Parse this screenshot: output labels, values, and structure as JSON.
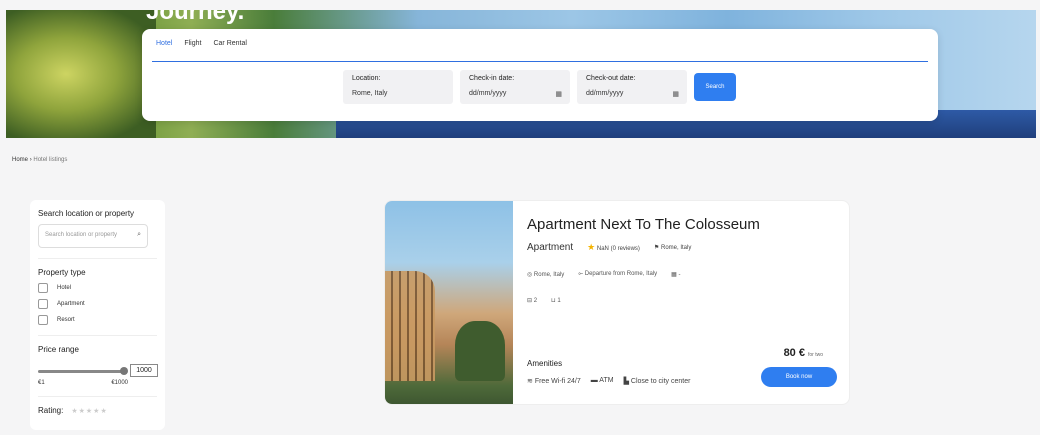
{
  "hero": {
    "title": "Journey."
  },
  "search": {
    "tabs": [
      "Hotel",
      "Flight",
      "Car Rental"
    ],
    "location_label": "Location:",
    "location_value": "Rome, Italy",
    "checkin_label": "Check-in date:",
    "checkin_value": "dd/mm/yyyy",
    "checkout_label": "Check-out date:",
    "checkout_value": "dd/mm/yyyy",
    "button": "Search"
  },
  "breadcrumb": {
    "home": "Home",
    "sep": "›",
    "current": "Hotel listings"
  },
  "sidebar": {
    "search_heading": "Search location or property",
    "search_placeholder": "Search location or property",
    "property_type_heading": "Property type",
    "types": [
      "Hotel",
      "Apartment",
      "Resort"
    ],
    "price_heading": "Price range",
    "price_value": "1000",
    "price_level": 1.0,
    "price_min": "€1",
    "price_max": "€1000",
    "rating_label": "Rating:",
    "rating_stars": "★★★★★"
  },
  "listing": {
    "title": "Apartment Next To The Colosseum",
    "type": "Apartment",
    "rating": "NaN",
    "reviews": "(0 reviews)",
    "location": "Rome, Italy",
    "location2": "Rome, Italy",
    "departure": "Departure from Rome, Italy",
    "date": "-",
    "beds": "2",
    "baths": "1",
    "amenities_heading": "Amenities",
    "amenities": [
      "Free Wi-fi 24/7",
      "ATM",
      "Close to city center"
    ],
    "price": "80 €",
    "price_note": "for two",
    "book": "Book now"
  }
}
